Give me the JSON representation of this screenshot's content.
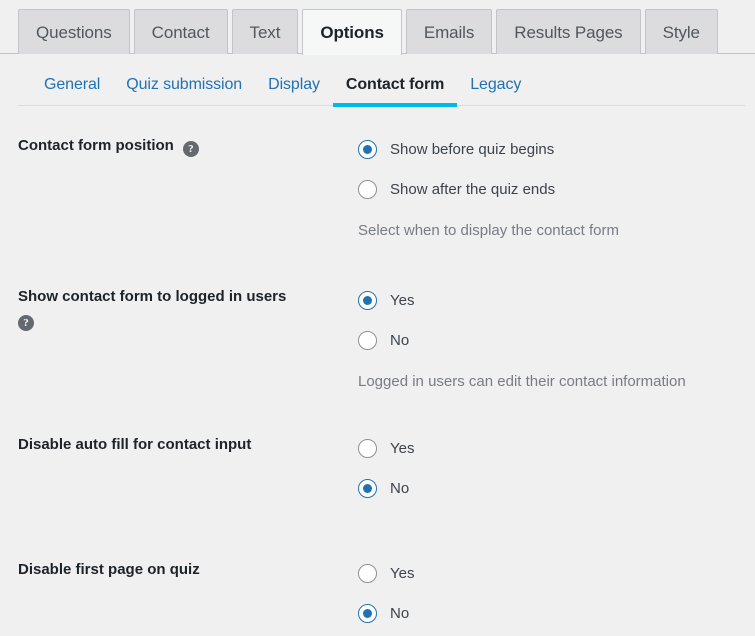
{
  "tabs": [
    {
      "label": "Questions",
      "active": false
    },
    {
      "label": "Contact",
      "active": false
    },
    {
      "label": "Text",
      "active": false
    },
    {
      "label": "Options",
      "active": true
    },
    {
      "label": "Emails",
      "active": false
    },
    {
      "label": "Results Pages",
      "active": false
    },
    {
      "label": "Style",
      "active": false
    }
  ],
  "subtabs": [
    {
      "label": "General",
      "active": false
    },
    {
      "label": "Quiz submission",
      "active": false
    },
    {
      "label": "Display",
      "active": false
    },
    {
      "label": "Contact form",
      "active": true
    },
    {
      "label": "Legacy",
      "active": false
    }
  ],
  "colors": {
    "accent_link": "#2271b1",
    "accent_underline": "#00b9eb",
    "page_background": "#f0f0f1",
    "tab_inactive": "#dcdcde",
    "tab_active": "#f6f7f7",
    "help_icon": "#646970",
    "description_text": "#787c82"
  },
  "help_icon_glyph": "?",
  "rows": [
    {
      "label": "Contact form position",
      "has_help": true,
      "help_inline": true,
      "options": [
        {
          "label": "Show before quiz begins",
          "checked": true
        },
        {
          "label": "Show after the quiz ends",
          "checked": false
        }
      ],
      "description": "Select when to display the contact form"
    },
    {
      "label": "Show contact form to logged in users",
      "has_help": true,
      "help_inline": false,
      "options": [
        {
          "label": "Yes",
          "checked": true
        },
        {
          "label": "No",
          "checked": false
        }
      ],
      "description": "Logged in users can edit their contact information"
    },
    {
      "label": "Disable auto fill for contact input",
      "has_help": false,
      "help_inline": true,
      "options": [
        {
          "label": "Yes",
          "checked": false
        },
        {
          "label": "No",
          "checked": true
        }
      ],
      "description": ""
    },
    {
      "label": "Disable first page on quiz",
      "has_help": false,
      "help_inline": true,
      "options": [
        {
          "label": "Yes",
          "checked": false
        },
        {
          "label": "No",
          "checked": true
        }
      ],
      "description": ""
    }
  ]
}
